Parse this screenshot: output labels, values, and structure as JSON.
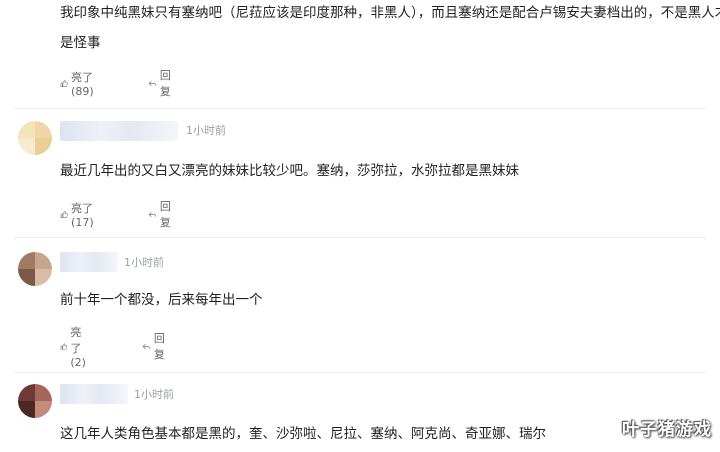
{
  "comments": [
    {
      "text_line1": "我印象中纯黑妹只有塞纳吧（尼菈应该是印度那种，非黑人），而且塞纳还是配合卢锡安夫妻档出的，不是黑人才",
      "text_line2": "是怪事",
      "like_label": "亮了(89)",
      "reply_label": "回复"
    },
    {
      "time": "1小时前",
      "text": "最近几年出的又白又漂亮的妹妹比较少吧。塞纳，莎弥拉，水弥拉都是黑妹妹",
      "like_label": "亮了(17)",
      "reply_label": "回复",
      "avatar_colors": [
        "#f3e3b8",
        "#eed7a4",
        "#f6ead0",
        "#e9cf95"
      ]
    },
    {
      "time": "1小时前",
      "text": "前十年一个都没，后来每年出一个",
      "like_label": "亮了(2)",
      "reply_label": "回复",
      "avatar_colors": [
        "#a07a64",
        "#c8a58d",
        "#7d5a48",
        "#d9bba6"
      ]
    },
    {
      "time": "1小时前",
      "text": "这几年人类角色基本都是黑的，奎、沙弥啦、尼拉、塞纳、阿克尚、奇亚娜、瑞尔",
      "avatar_colors": [
        "#6f3a35",
        "#a8655c",
        "#4e2824",
        "#c48b7d"
      ]
    }
  ],
  "watermark": "叶子猪游戏",
  "colors": {
    "text": "#1f1f1f",
    "meta": "#9aa0a8",
    "divider": "#ececec"
  }
}
